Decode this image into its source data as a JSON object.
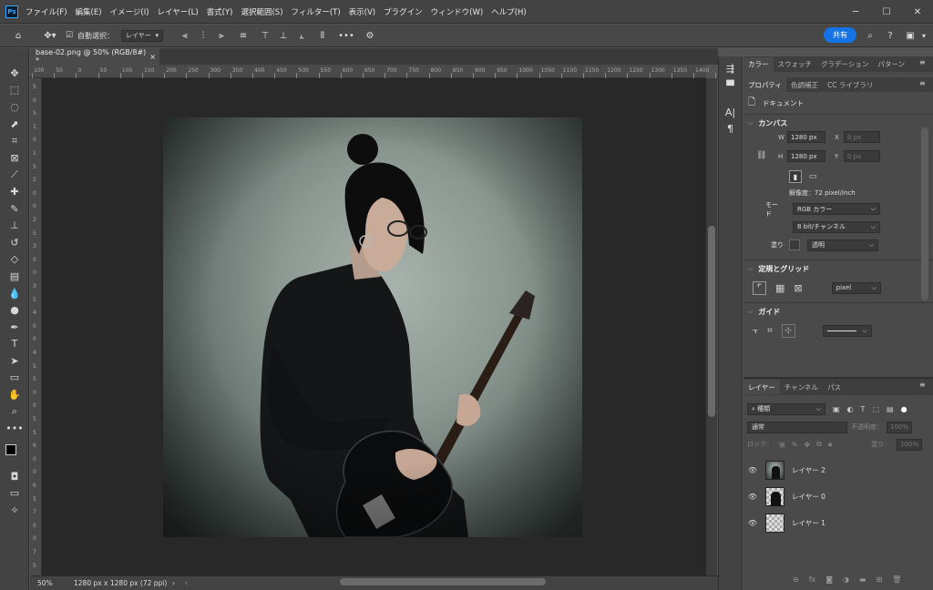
{
  "app": {
    "logo": "Ps",
    "share_label": "共有"
  },
  "menu": [
    "ファイル(F)",
    "編集(E)",
    "イメージ(I)",
    "レイヤー(L)",
    "書式(Y)",
    "選択範囲(S)",
    "フィルター(T)",
    "表示(V)",
    "プラグイン",
    "ウィンドウ(W)",
    "ヘルプ(H)"
  ],
  "options": {
    "auto_select_label": "自動選択：",
    "auto_select_target": "レイヤー",
    "more": "•••"
  },
  "document": {
    "tab_title": "base-02.png @ 50% (RGB/8#) *",
    "close": "×"
  },
  "ruler_h": [
    "100",
    "50",
    "0",
    "50",
    "100",
    "150",
    "200",
    "250",
    "300",
    "350",
    "400",
    "450",
    "500",
    "550",
    "600",
    "650",
    "700",
    "750",
    "800",
    "850",
    "900",
    "950",
    "1000",
    "1050",
    "1100",
    "1150",
    "1200",
    "1250",
    "1300",
    "1350",
    "1400",
    "1450",
    "1500",
    "1550",
    "1600"
  ],
  "ruler_v": [
    "5",
    "0",
    "5",
    "1",
    "0",
    "1",
    "5",
    "2",
    "0",
    "0",
    "2",
    "5",
    "3",
    "0",
    "0",
    "3",
    "5",
    "4",
    "0",
    "0",
    "4",
    "5",
    "5",
    "0",
    "0",
    "5",
    "5",
    "6",
    "0",
    "0",
    "6",
    "5",
    "7",
    "0",
    "0",
    "7",
    "5"
  ],
  "status": {
    "zoom": "50%",
    "info": "1280 px x 1280 px (72 ppi)",
    "arrow": "›"
  },
  "top_panel_tabs": [
    "カラー",
    "スウォッチ",
    "グラデーション",
    "パターン"
  ],
  "prop_tabs": [
    "プロパティ",
    "色調補正",
    "CC ライブラリ"
  ],
  "properties": {
    "doc_label": "ドキュメント",
    "canvas_title": "カンバス",
    "w_label": "W",
    "w_value": "1280 px",
    "h_label": "H",
    "h_value": "1280 px",
    "x_label": "X",
    "x_value": "0 px",
    "y_label": "Y",
    "y_value": "0 px",
    "resolution": "解像度：72 pixel/inch",
    "mode_label": "モード",
    "mode_value": "RGB カラー",
    "depth_value": "8 bit/チャンネル",
    "fill_label": "塗り",
    "fill_value": "透明",
    "rulers_title": "定規とグリッド",
    "ruler_unit": "pixel",
    "guides_title": "ガイド"
  },
  "layer_tabs": [
    "レイヤー",
    "チャンネル",
    "パス"
  ],
  "layers_panel": {
    "filter_kind": "種類",
    "blend_mode": "通常",
    "opacity_label": "不透明度：",
    "opacity_value": "100%",
    "lock_label": "ロック：",
    "fill_label": "塗り：",
    "fill_value": "100%",
    "layers": [
      {
        "name": "レイヤー 2",
        "thumb": "photo"
      },
      {
        "name": "レイヤー 0",
        "thumb": "cutout"
      },
      {
        "name": "レイヤー 1",
        "thumb": "transparent"
      }
    ]
  },
  "colors": {
    "accent": "#1473e6",
    "panel": "#4a4a4a",
    "canvas_bg": "#282828"
  }
}
